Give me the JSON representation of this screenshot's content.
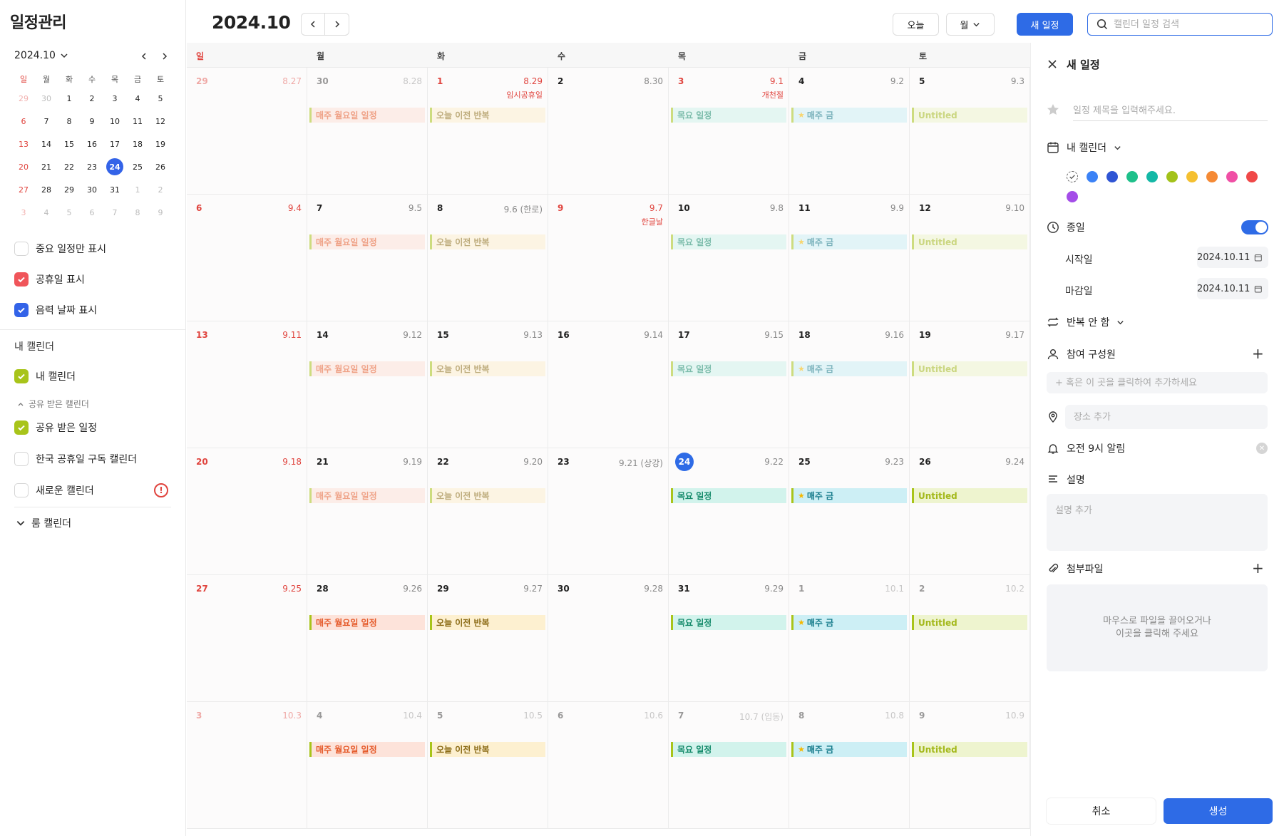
{
  "app": {
    "title": "일정관리"
  },
  "mini_calendar": {
    "month_label": "2024.10",
    "weekdays": [
      "일",
      "월",
      "화",
      "수",
      "목",
      "금",
      "토"
    ],
    "days": [
      {
        "d": "29",
        "dim": true
      },
      {
        "d": "30",
        "dim": true
      },
      {
        "d": "1"
      },
      {
        "d": "2"
      },
      {
        "d": "3"
      },
      {
        "d": "4"
      },
      {
        "d": "5"
      },
      {
        "d": "6"
      },
      {
        "d": "7"
      },
      {
        "d": "8"
      },
      {
        "d": "9"
      },
      {
        "d": "10"
      },
      {
        "d": "11"
      },
      {
        "d": "12"
      },
      {
        "d": "13"
      },
      {
        "d": "14"
      },
      {
        "d": "15"
      },
      {
        "d": "16"
      },
      {
        "d": "17"
      },
      {
        "d": "18"
      },
      {
        "d": "19"
      },
      {
        "d": "20"
      },
      {
        "d": "21"
      },
      {
        "d": "22"
      },
      {
        "d": "23"
      },
      {
        "d": "24",
        "today": true
      },
      {
        "d": "25"
      },
      {
        "d": "26"
      },
      {
        "d": "27"
      },
      {
        "d": "28"
      },
      {
        "d": "29"
      },
      {
        "d": "30"
      },
      {
        "d": "31"
      },
      {
        "d": "1",
        "dim": true
      },
      {
        "d": "2",
        "dim": true
      },
      {
        "d": "3",
        "dim": true
      },
      {
        "d": "4",
        "dim": true
      },
      {
        "d": "5",
        "dim": true
      },
      {
        "d": "6",
        "dim": true
      },
      {
        "d": "7",
        "dim": true
      },
      {
        "d": "8",
        "dim": true
      },
      {
        "d": "9",
        "dim": true
      }
    ]
  },
  "sidebar": {
    "options": [
      {
        "label": "중요 일정만 표시",
        "checked": false,
        "color": ""
      },
      {
        "label": "공휴일 표시",
        "checked": true,
        "color": "#f0555a"
      },
      {
        "label": "음력 날짜 표시",
        "checked": true,
        "color": "#3363e8"
      }
    ],
    "my_calendars_label": "내 캘린더",
    "my_calendars": [
      {
        "label": "내 캘린더",
        "checked": true,
        "color": "#a8c41a"
      }
    ],
    "shared_label": "공유 받은 캘린더",
    "shared": [
      {
        "label": "공유 받은 일정",
        "checked": true,
        "color": "#a8c41a"
      },
      {
        "label": "한국 공휴일 구독 캘린더",
        "checked": false,
        "color": ""
      },
      {
        "label": "새로운 캘린더",
        "checked": false,
        "color": "",
        "warning": "!"
      }
    ],
    "room_label": "룸 캘린더"
  },
  "toolbar": {
    "title": "2024.10",
    "today_label": "오늘",
    "view_label": "월",
    "new_label": "새 일정",
    "search_placeholder": "캘린더 일정 검색"
  },
  "calendar": {
    "weekdays": [
      "일",
      "월",
      "화",
      "수",
      "목",
      "금",
      "토"
    ],
    "weeks": [
      [
        {
          "d": "29",
          "l": "8.27",
          "dim": true
        },
        {
          "d": "30",
          "l": "8.28",
          "dim": true,
          "ev": "mon",
          "past": true
        },
        {
          "d": "1",
          "l": "8.29",
          "hol": "임시공휴일",
          "red": true,
          "ev": "tue",
          "past": true
        },
        {
          "d": "2",
          "l": "8.30"
        },
        {
          "d": "3",
          "l": "9.1",
          "hol": "개천절",
          "red": true,
          "ev": "thu",
          "past": true
        },
        {
          "d": "4",
          "l": "9.2",
          "ev": "fri",
          "past": true
        },
        {
          "d": "5",
          "l": "9.3",
          "ev": "sat",
          "past": true
        }
      ],
      [
        {
          "d": "6",
          "l": "9.4"
        },
        {
          "d": "7",
          "l": "9.5",
          "ev": "mon",
          "past": true
        },
        {
          "d": "8",
          "l": "9.6 (한로)",
          "ev": "tue",
          "past": true
        },
        {
          "d": "9",
          "l": "9.7",
          "hol": "한글날",
          "red": true
        },
        {
          "d": "10",
          "l": "9.8",
          "ev": "thu",
          "past": true
        },
        {
          "d": "11",
          "l": "9.9",
          "ev": "fri",
          "past": true
        },
        {
          "d": "12",
          "l": "9.10",
          "ev": "sat",
          "past": true
        }
      ],
      [
        {
          "d": "13",
          "l": "9.11"
        },
        {
          "d": "14",
          "l": "9.12",
          "ev": "mon",
          "past": true
        },
        {
          "d": "15",
          "l": "9.13",
          "ev": "tue",
          "past": true
        },
        {
          "d": "16",
          "l": "9.14"
        },
        {
          "d": "17",
          "l": "9.15",
          "ev": "thu",
          "past": true
        },
        {
          "d": "18",
          "l": "9.16",
          "ev": "fri",
          "past": true
        },
        {
          "d": "19",
          "l": "9.17",
          "ev": "sat",
          "past": true
        }
      ],
      [
        {
          "d": "20",
          "l": "9.18"
        },
        {
          "d": "21",
          "l": "9.19",
          "ev": "mon",
          "past": true
        },
        {
          "d": "22",
          "l": "9.20",
          "ev": "tue",
          "past": true
        },
        {
          "d": "23",
          "l": "9.21 (상강)"
        },
        {
          "d": "24",
          "l": "9.22",
          "today": true,
          "ev": "thu"
        },
        {
          "d": "25",
          "l": "9.23",
          "ev": "fri"
        },
        {
          "d": "26",
          "l": "9.24",
          "ev": "sat"
        }
      ],
      [
        {
          "d": "27",
          "l": "9.25"
        },
        {
          "d": "28",
          "l": "9.26",
          "ev": "mon"
        },
        {
          "d": "29",
          "l": "9.27",
          "ev": "tue"
        },
        {
          "d": "30",
          "l": "9.28"
        },
        {
          "d": "31",
          "l": "9.29",
          "ev": "thu"
        },
        {
          "d": "1",
          "l": "10.1",
          "dim": true,
          "ev": "fri"
        },
        {
          "d": "2",
          "l": "10.2",
          "dim": true,
          "ev": "sat"
        }
      ],
      [
        {
          "d": "3",
          "l": "10.3",
          "dim": true
        },
        {
          "d": "4",
          "l": "10.4",
          "dim": true,
          "ev": "mon"
        },
        {
          "d": "5",
          "l": "10.5",
          "dim": true,
          "ev": "tue"
        },
        {
          "d": "6",
          "l": "10.6",
          "dim": true
        },
        {
          "d": "7",
          "l": "10.7 (입동)",
          "dim": true,
          "ev": "thu"
        },
        {
          "d": "8",
          "l": "10.8",
          "dim": true,
          "ev": "fri"
        },
        {
          "d": "9",
          "l": "10.9",
          "dim": true,
          "ev": "sat"
        }
      ]
    ],
    "event_types": {
      "mon": {
        "label": "매주 월요일 일정",
        "bg": "#fde3da",
        "bar": "#a8c41a",
        "fg": "#e55a2a",
        "star": false
      },
      "tue": {
        "label": "오늘 이전 반복",
        "bg": "#fdf0d0",
        "bar": "#a8c41a",
        "fg": "#8a6a14",
        "star": false
      },
      "thu": {
        "label": "목요 일정",
        "bg": "#d2f3ec",
        "bar": "#a8c41a",
        "fg": "#148a6a",
        "star": false
      },
      "fri": {
        "label": "매주 금",
        "bg": "#cdeff5",
        "bar": "#a8c41a",
        "fg": "#147a8a",
        "star": true
      },
      "sat": {
        "label": "Untitled",
        "bg": "#eef4cf",
        "bar": "#a8c41a",
        "fg": "#a3b81a",
        "star": false
      }
    }
  },
  "panel": {
    "title": "새 일정",
    "title_placeholder": "일정 제목을 입력해주세요.",
    "calendar_label": "내 캘린더",
    "colors": [
      "#3b82f6",
      "#2f55d4",
      "#1ec08a",
      "#14b8a6",
      "#a3c21a",
      "#f5c030",
      "#f58a35",
      "#f04fa5",
      "#f04848",
      "#a44de8"
    ],
    "allday_label": "종일",
    "start_label": "시작일",
    "start_value": "2024.10.11",
    "end_label": "마감일",
    "end_value": "2024.10.11",
    "repeat_label": "반복 안 함",
    "members_label": "참여 구성원",
    "members_placeholder": "+ 혹은 이 곳을 클릭하여 추가하세요",
    "location_placeholder": "장소 추가",
    "alarm_label": "오전 9시 알림",
    "desc_label": "설명",
    "desc_placeholder": "설명 추가",
    "attach_label": "첨부파일",
    "drop_line1": "마우스로 파일을 끌어오거나",
    "drop_line2": "이곳을 클릭해 주세요",
    "cancel_label": "취소",
    "create_label": "생성"
  }
}
